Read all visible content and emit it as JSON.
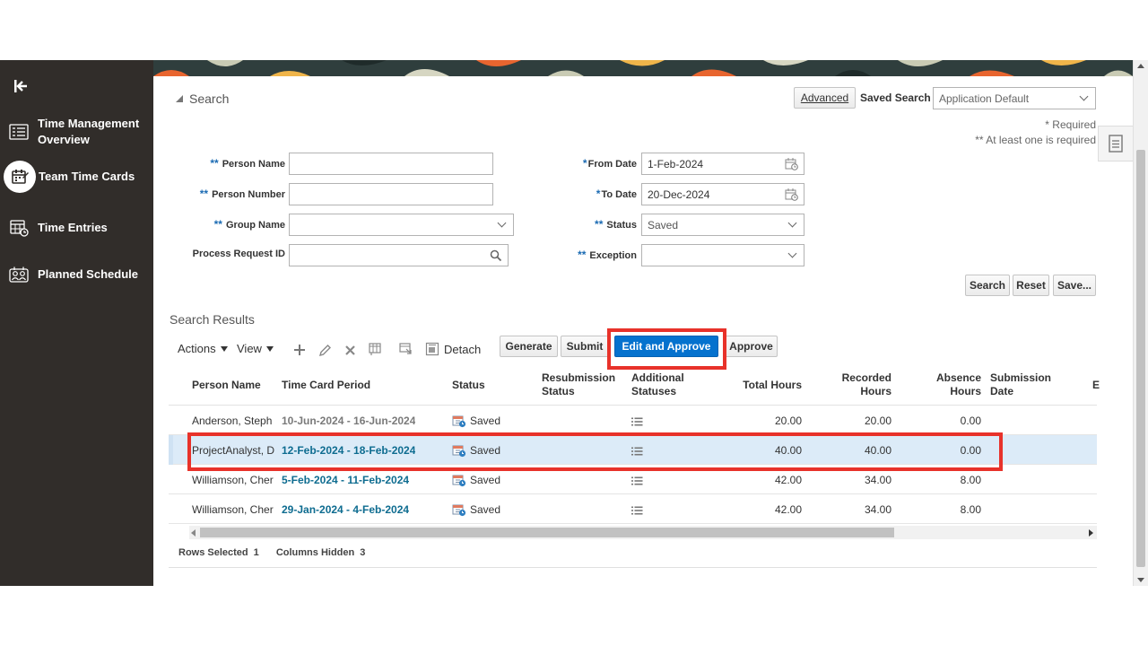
{
  "sidebar": {
    "items": [
      {
        "label": "Time Management Overview",
        "icon": "overview-icon"
      },
      {
        "label": "Team Time Cards",
        "icon": "team-time-cards-icon",
        "active": true
      },
      {
        "label": "Time Entries",
        "icon": "time-entries-icon"
      },
      {
        "label": "Planned Schedule",
        "icon": "planned-schedule-icon"
      }
    ]
  },
  "search": {
    "title": "Search",
    "advanced_label": "Advanced",
    "saved_search_label": "Saved Search",
    "saved_search_value": "Application Default",
    "required_note": "* Required",
    "at_least_one_note": "** At least one is required",
    "fields": {
      "person_name": {
        "req": "**",
        "label": "Person Name",
        "value": ""
      },
      "person_number": {
        "req": "**",
        "label": "Person Number",
        "value": ""
      },
      "group_name": {
        "req": "**",
        "label": "Group Name",
        "value": ""
      },
      "process_request_id": {
        "label": "Process Request ID",
        "value": ""
      },
      "from_date": {
        "req": "*",
        "label": "From Date",
        "value": "1-Feb-2024"
      },
      "to_date": {
        "req": "*",
        "label": "To Date",
        "value": "20-Dec-2024"
      },
      "status": {
        "req": "**",
        "label": "Status",
        "value": "Saved"
      },
      "exception": {
        "req": "**",
        "label": "Exception",
        "value": ""
      }
    },
    "buttons": {
      "search": "Search",
      "reset": "Reset",
      "save": "Save..."
    }
  },
  "results": {
    "title": "Search Results",
    "toolbar": {
      "actions": "Actions",
      "view": "View",
      "detach": "Detach",
      "generate": "Generate",
      "submit": "Submit",
      "edit_and_approve": "Edit and Approve",
      "approve": "Approve"
    },
    "columns": {
      "person_name": "Person Name",
      "time_card_period": "Time Card Period",
      "status": "Status",
      "resubmission_status_1": "Resubmission",
      "resubmission_status_2": "Status",
      "additional_statuses_1": "Additional",
      "additional_statuses_2": "Statuses",
      "total_hours": "Total Hours",
      "recorded_hours_1": "Recorded",
      "recorded_hours_2": "Hours",
      "absence_hours_1": "Absence",
      "absence_hours_2": "Hours",
      "submission_date_1": "Submission",
      "submission_date_2": "Date",
      "extra": "E"
    },
    "rows": [
      {
        "person": "Anderson, Steph",
        "period": "10-Jun-2024 - 16-Jun-2024",
        "status": "Saved",
        "total": "20.00",
        "recorded": "20.00",
        "absence": "0.00"
      },
      {
        "person": "ProjectAnalyst, D",
        "period": "12-Feb-2024 - 18-Feb-2024",
        "status": "Saved",
        "total": "40.00",
        "recorded": "40.00",
        "absence": "0.00",
        "selected": true
      },
      {
        "person": "Williamson, Cher",
        "period": "5-Feb-2024 - 11-Feb-2024",
        "status": "Saved",
        "total": "42.00",
        "recorded": "34.00",
        "absence": "8.00"
      },
      {
        "person": "Williamson, Cher",
        "period": "29-Jan-2024 - 4-Feb-2024",
        "status": "Saved",
        "total": "42.00",
        "recorded": "34.00",
        "absence": "8.00"
      }
    ],
    "footer": {
      "rows_selected_label": "Rows Selected",
      "rows_selected_value": "1",
      "columns_hidden_label": "Columns Hidden",
      "columns_hidden_value": "3"
    }
  },
  "colors": {
    "sidebar_bg": "#312d2a",
    "primary": "#0572ce",
    "highlight": "#e8322a",
    "link": "#0e6c90",
    "selected_row": "#dcebf8"
  }
}
